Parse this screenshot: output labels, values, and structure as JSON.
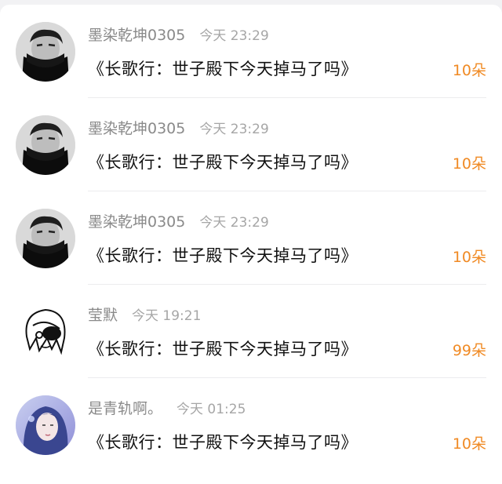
{
  "comments": [
    {
      "user": "墨染乾坤0305",
      "time": "今天 23:29",
      "text": "《长歌行：世子殿下今天掉马了吗》",
      "flowers": "10朵",
      "avatar": "masked-man-avatar"
    },
    {
      "user": "墨染乾坤0305",
      "time": "今天 23:29",
      "text": "《长歌行：世子殿下今天掉马了吗》",
      "flowers": "10朵",
      "avatar": "masked-man-avatar"
    },
    {
      "user": "墨染乾坤0305",
      "time": "今天 23:29",
      "text": "《长歌行：世子殿下今天掉马了吗》",
      "flowers": "10朵",
      "avatar": "masked-man-avatar"
    },
    {
      "user": "莹默",
      "time": "今天 19:21",
      "text": "《长歌行：世子殿下今天掉马了吗》",
      "flowers": "99朵",
      "avatar": "anime-girl-sketch-avatar"
    },
    {
      "user": "是青轨啊。",
      "time": "今天 01:25",
      "text": "《长歌行：世子殿下今天掉马了吗》",
      "flowers": "10朵",
      "avatar": "blue-haired-girl-avatar"
    }
  ],
  "colors": {
    "accent": "#f08a24",
    "username": "#8a8a8a",
    "timestamp": "#a6a6a6",
    "text": "#111111",
    "background": "#ffffff"
  }
}
